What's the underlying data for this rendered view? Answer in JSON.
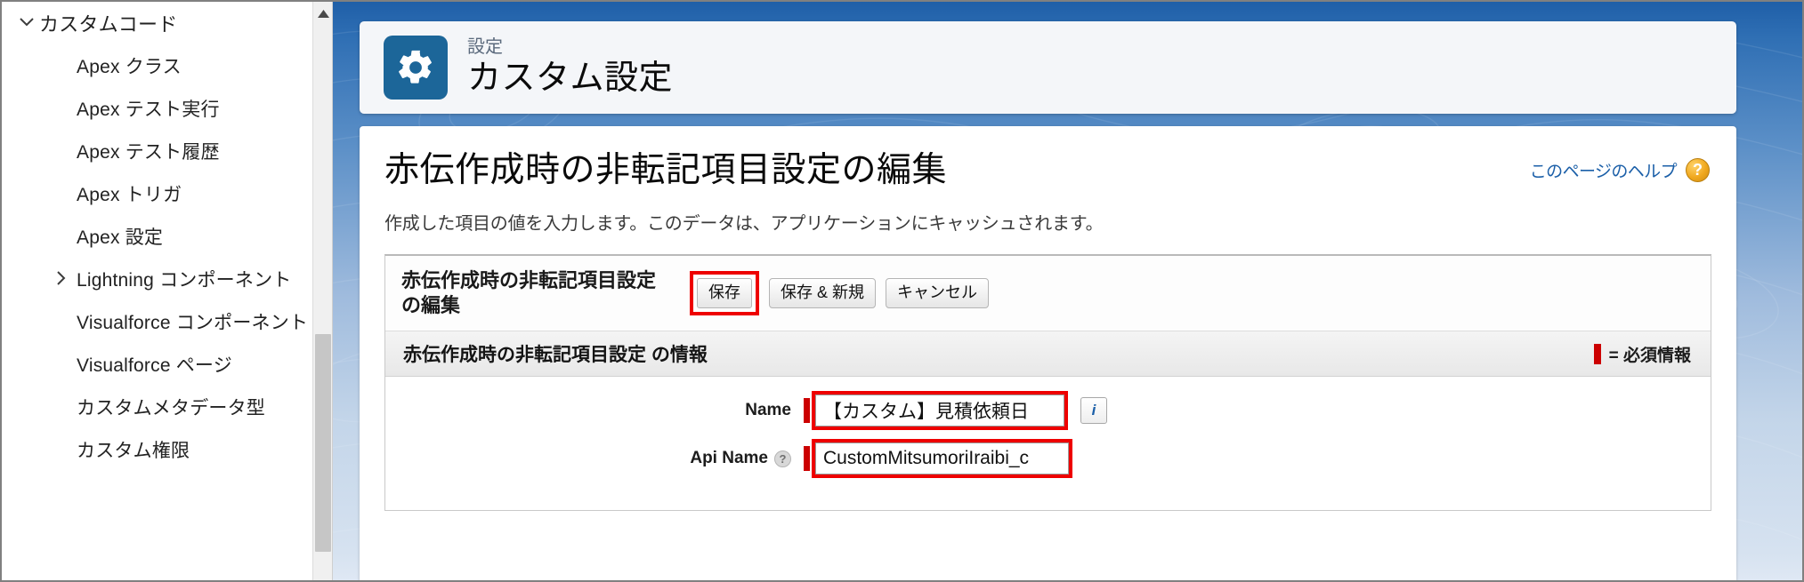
{
  "sidebar": {
    "items": [
      {
        "label": "カスタムコード",
        "level": 0,
        "caret": "chevron-down"
      },
      {
        "label": "Apex クラス",
        "level": 1,
        "caret": ""
      },
      {
        "label": "Apex テスト実行",
        "level": 1,
        "caret": ""
      },
      {
        "label": "Apex テスト履歴",
        "level": 1,
        "caret": ""
      },
      {
        "label": "Apex トリガ",
        "level": 1,
        "caret": ""
      },
      {
        "label": "Apex 設定",
        "level": 1,
        "caret": ""
      },
      {
        "label": "Lightning コンポーネント",
        "level": 1,
        "caret": "chevron-right"
      },
      {
        "label": "Visualforce コンポーネント",
        "level": 1,
        "caret": ""
      },
      {
        "label": "Visualforce ページ",
        "level": 1,
        "caret": ""
      },
      {
        "label": "カスタムメタデータ型",
        "level": 1,
        "caret": ""
      },
      {
        "label": "カスタム権限",
        "level": 1,
        "caret": ""
      }
    ]
  },
  "header": {
    "eyebrow": "設定",
    "title": "カスタム設定",
    "icon": "gear-icon"
  },
  "page": {
    "title": "赤伝作成時の非転記項目設定の編集",
    "description": "作成した項目の値を入力します。このデータは、アプリケーションにキャッシュされます。",
    "help_link": "このページのヘルプ",
    "help_icon": "question-mark-icon"
  },
  "panel": {
    "title": "赤伝作成時の非転記項目設定 の編集",
    "buttons": {
      "save": "保存",
      "save_new": "保存 & 新規",
      "cancel": "キャンセル"
    },
    "section_title": "赤伝作成時の非転記項目設定 の情報",
    "required_note": "= 必須情報",
    "fields": [
      {
        "label": "Name",
        "value": "【カスタム】見積依頼日",
        "required": true,
        "highlighted": true,
        "has_label_help": false,
        "trailing_icon": "info-icon"
      },
      {
        "label": "Api Name",
        "value": "CustomMitsumoriIraibi_c",
        "required": true,
        "highlighted": true,
        "has_label_help": true,
        "trailing_icon": ""
      }
    ]
  },
  "colors": {
    "accent_blue": "#1c6699",
    "highlight_red": "#ee0000",
    "required_red": "#cc0000",
    "link_blue": "#1b5fa8",
    "help_orange": "#f0a81e"
  }
}
